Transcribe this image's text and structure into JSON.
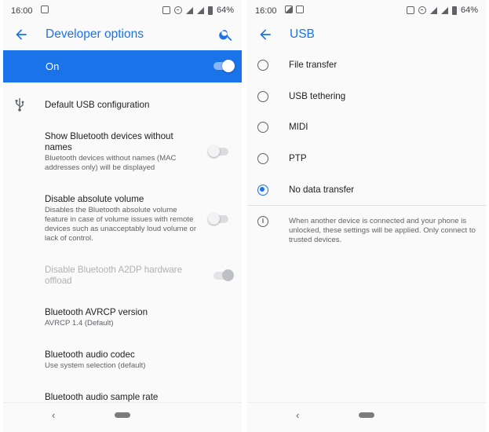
{
  "status_bar": {
    "time": "16:00",
    "battery": "64%"
  },
  "left": {
    "title": "Developer options",
    "master": {
      "label": "On",
      "on": true
    },
    "usb_default": "Default USB configuration",
    "settings": [
      {
        "title": "Show Bluetooth devices without names",
        "summary": "Bluetooth devices without names (MAC addresses only) will be displayed",
        "toggle": "off"
      },
      {
        "title": "Disable absolute volume",
        "summary": "Disables the Bluetooth absolute volume feature in case of volume issues with remote devices such as unacceptably loud volume or lack of control.",
        "toggle": "off"
      },
      {
        "title": "Disable Bluetooth A2DP hardware offload",
        "toggle": "on-disabled"
      },
      {
        "title": "Bluetooth AVRCP version",
        "summary": "AVRCP 1.4 (Default)"
      },
      {
        "title": "Bluetooth audio codec",
        "summary": "Use system selection (default)"
      },
      {
        "title": "Bluetooth audio sample rate"
      }
    ]
  },
  "right": {
    "title": "USB",
    "options": [
      {
        "label": "File transfer",
        "selected": false
      },
      {
        "label": "USB tethering",
        "selected": false
      },
      {
        "label": "MIDI",
        "selected": false
      },
      {
        "label": "PTP",
        "selected": false
      },
      {
        "label": "No data transfer",
        "selected": true
      }
    ],
    "info": "When another device is connected and your phone is unlocked, these settings will be applied. Only connect to trusted devices."
  },
  "navigation": {
    "back_glyph": "‹"
  },
  "colors": {
    "accent": "#1a73e8",
    "text_primary": "#202124",
    "text_secondary": "#5f6368",
    "disabled": "#aeb0b3"
  },
  "icons": [
    "back-arrow-icon",
    "search-icon",
    "usb-icon",
    "info-icon",
    "wifi-icon",
    "signal-icon",
    "battery-icon",
    "vibrate-icon",
    "dnd-icon"
  ]
}
